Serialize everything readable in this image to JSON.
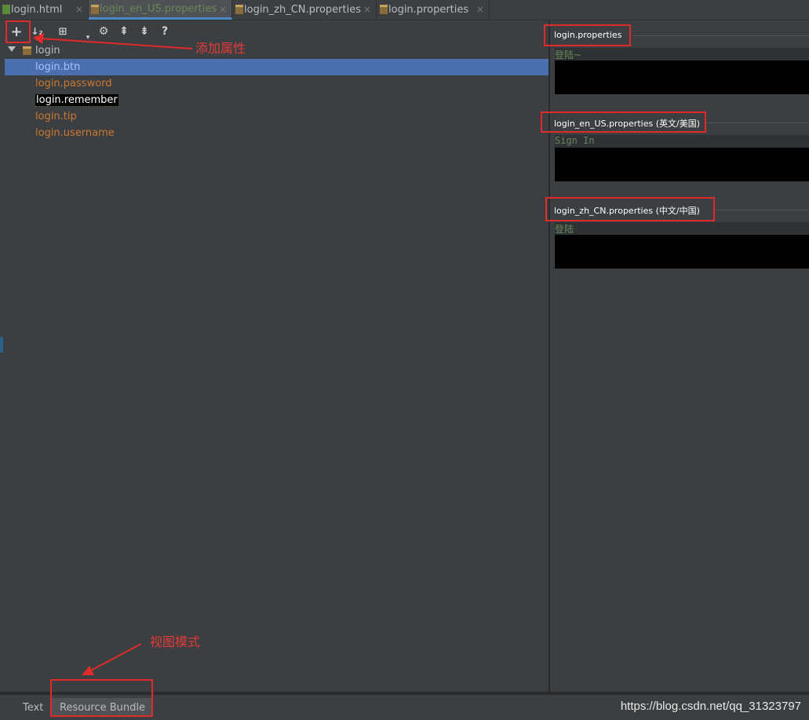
{
  "tabs": [
    {
      "label": "login.html",
      "icon": "html-file-icon"
    },
    {
      "label": "login_en_US.properties",
      "icon": "properties-file-icon"
    },
    {
      "label": "login_zh_CN.properties",
      "icon": "properties-file-icon"
    },
    {
      "label": "login.properties",
      "icon": "properties-file-icon"
    }
  ],
  "close_glyph": "×",
  "toolbar": {
    "add": "+",
    "sort": "↓₂",
    "group": "⊞",
    "dropdown": "▾",
    "settings": "⚙",
    "expand": "⇞",
    "collapse": "⇟",
    "help": "?"
  },
  "tree": {
    "root": "login",
    "items": [
      {
        "label": "login.btn",
        "state": "selected"
      },
      {
        "label": "login.password",
        "state": "normal"
      },
      {
        "label": "login.remember",
        "state": "highlighted"
      },
      {
        "label": "login.tip",
        "state": "normal"
      },
      {
        "label": "login.username",
        "state": "normal"
      }
    ]
  },
  "annotations": {
    "add_property": "添加属性",
    "view_mode": "视图模式"
  },
  "sections": [
    {
      "title": "login.properties",
      "value": "登陆~"
    },
    {
      "title": "login_en_US.properties (英文/美国)",
      "value": "Sign In"
    },
    {
      "title": "login_zh_CN.properties (中文/中国)",
      "value": "登陆"
    }
  ],
  "bottom_tabs": [
    {
      "label": "Text"
    },
    {
      "label": "Resource Bundle"
    }
  ],
  "footer_url": "https://blog.csdn.net/qq_31323797",
  "colors": {
    "accent": "#4a88c7",
    "selection": "#4b6eaf",
    "key_orange": "#cc7832",
    "annotation_red": "#e02b2b"
  }
}
